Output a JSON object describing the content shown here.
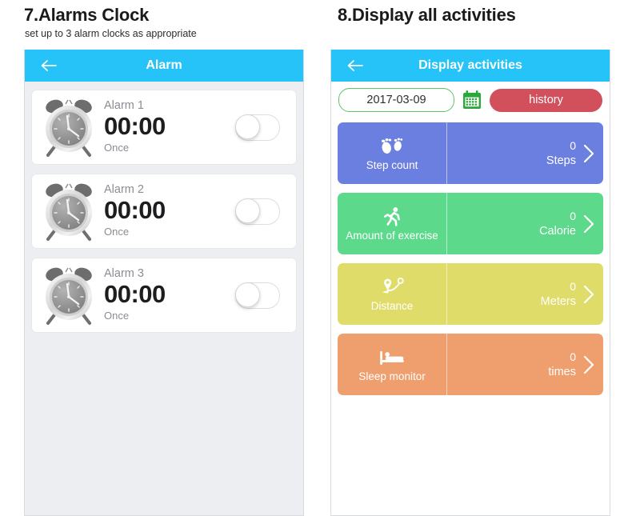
{
  "sections": [
    {
      "title": "7.Alarms Clock",
      "subtitle": "set up to 3 alarm clocks as appropriate",
      "appbar": {
        "title": "Alarm",
        "back_icon": "arrow-left-icon"
      }
    },
    {
      "title": "8.Display all activities",
      "subtitle": "",
      "appbar": {
        "title": "Display activities",
        "back_icon": "arrow-left-icon"
      }
    }
  ],
  "alarms": [
    {
      "name": "Alarm 1",
      "time": "00:00",
      "repeat": "Once",
      "enabled": false,
      "icon": "alarm-clock-icon"
    },
    {
      "name": "Alarm 2",
      "time": "00:00",
      "repeat": "Once",
      "enabled": false,
      "icon": "alarm-clock-icon"
    },
    {
      "name": "Alarm 3",
      "time": "00:00",
      "repeat": "Once",
      "enabled": false,
      "icon": "alarm-clock-icon"
    }
  ],
  "activities_toolbar": {
    "date_value": "2017-03-09",
    "calendar_icon": "calendar-icon",
    "history_label": "history"
  },
  "activities": [
    {
      "label": "Step count",
      "value": "0",
      "unit": "Steps",
      "color": "#6b7fe0",
      "icon": "footprints-icon"
    },
    {
      "label": "Amount of exercise",
      "value": "0",
      "unit": "Calorie",
      "color": "#5cd98a",
      "icon": "running-icon"
    },
    {
      "label": "Distance",
      "value": "0",
      "unit": "Meters",
      "color": "#e0dc6a",
      "icon": "route-pin-icon"
    },
    {
      "label": "Sleep monitor",
      "value": "0",
      "unit": "times",
      "color": "#ef9e6e",
      "icon": "bed-icon"
    }
  ],
  "colors": {
    "appbar_blue": "#25c3f7",
    "history_red": "#d2505c",
    "date_border_green": "#5cc46a",
    "panel_gray": "#eceef2"
  }
}
